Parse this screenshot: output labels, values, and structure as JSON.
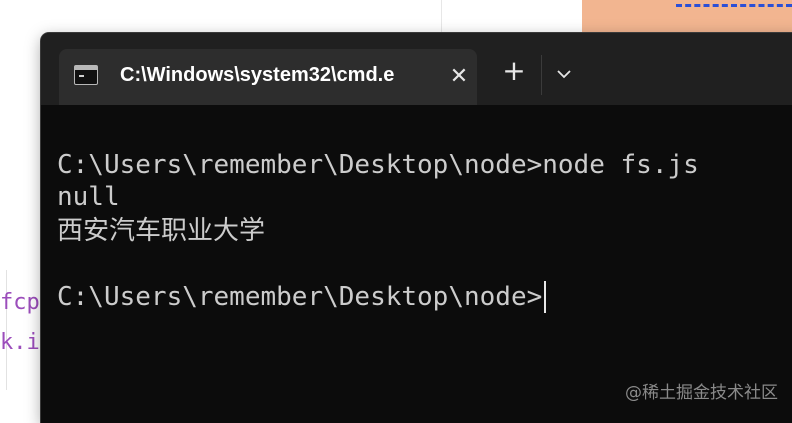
{
  "background": {
    "code_fragments": [
      "fcp",
      "k.i"
    ]
  },
  "window": {
    "tab_title": "C:\\Windows\\system32\\cmd.e",
    "close_glyph": "✕",
    "new_tab_glyph": "+"
  },
  "terminal": {
    "lines": [
      "C:\\Users\\remember\\Desktop\\node>node fs.js",
      "null",
      "西安汽车职业大学",
      "",
      "C:\\Users\\remember\\Desktop\\node>"
    ]
  },
  "watermark": "@稀土掘金技术社区",
  "colors": {
    "terminal_bg": "#0c0c0c",
    "titlebar_bg": "#202020",
    "tab_bg": "#2d2d2d",
    "text": "#cccccc",
    "code_purple": "#9b4dbb",
    "peach": "#f2b590",
    "dash_blue": "#2b4fd6"
  },
  "icons": [
    "cmd-prompt-icon",
    "close-icon",
    "plus-icon",
    "chevron-down-icon"
  ]
}
